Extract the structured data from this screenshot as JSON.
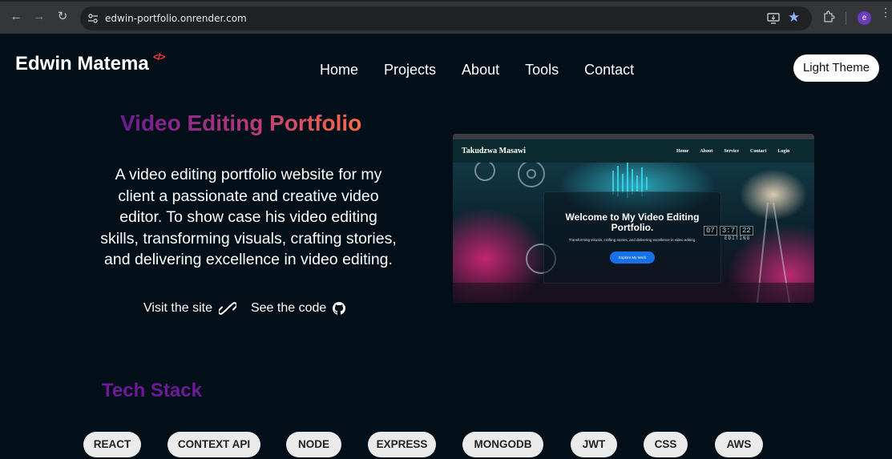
{
  "browser": {
    "url": "edwin-portfolio.onrender.com",
    "profile_initial": "e",
    "icons": [
      "back-icon",
      "forward-icon",
      "reload-icon",
      "site-settings-icon",
      "install-app-icon",
      "bookmark-star-icon",
      "extensions-icon",
      "menu-icon"
    ]
  },
  "header": {
    "brand": "Edwin Matema",
    "brand_mark": "</>",
    "nav": [
      "Home",
      "Projects",
      "About",
      "Tools",
      "Contact"
    ],
    "theme_button": "Light Theme"
  },
  "project": {
    "title": "Video Editing Portfolio",
    "description": "A video editing portfolio website for my client a passionate and creative video editor. To show case his video editing skills, transforming visuals, crafting stories, and delivering excellence in video editing.",
    "visit_label": "Visit the site",
    "code_label": "See the code",
    "preview": {
      "site_name": "Takudzwa Masawi",
      "menu": [
        "Home",
        "About",
        "Service",
        "Contact",
        "Login"
      ],
      "welcome": "Welcome to My Video Editing Portfolio.",
      "tagline": "Transforming visuals, crafting stories, and delivering excellence in video editing.",
      "button": "Explore My Work",
      "clock": [
        "07",
        "3:7",
        "22"
      ],
      "clock_label": "EDITING"
    }
  },
  "tech_stack": {
    "title": "Tech Stack",
    "items": [
      "REACT",
      "CONTEXT API",
      "NODE",
      "EXPRESS",
      "MONGODB",
      "JWT",
      "CSS",
      "AWS"
    ]
  },
  "colors": {
    "page_bg": "#020f19",
    "brand_mark": "#ff3b3b",
    "title_gradient_start": "#6c1a95",
    "title_gradient_end": "#ff6a46",
    "stack_title": "#6c1a95",
    "chip_bg": "#eaeaea"
  }
}
